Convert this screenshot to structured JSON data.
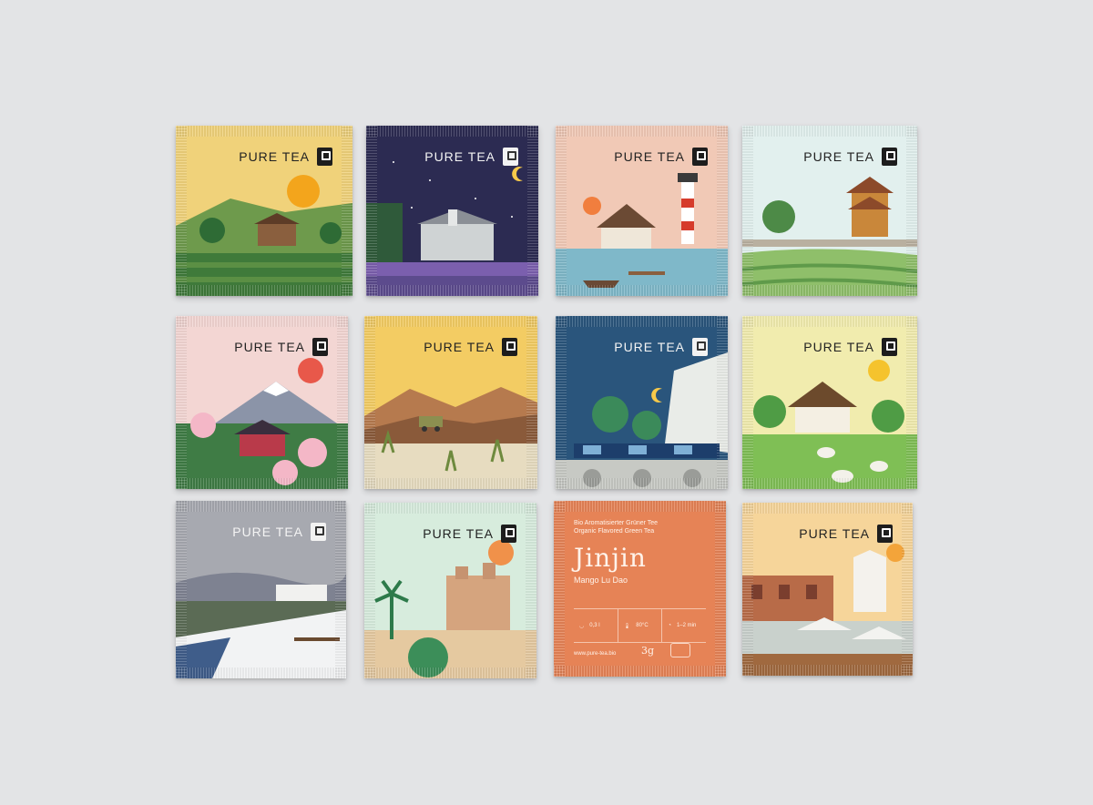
{
  "brand": "PURE TEA",
  "jinjin": {
    "subtitle_de": "Bio Aromatisierter Grüner Tee",
    "subtitle_en": "Organic Flavored Green Tea",
    "name": "Jinjin",
    "variety": "Mango Lu Dao",
    "volume": "0,3 l",
    "temperature": "80°C",
    "time": "1–2 min",
    "url": "www.pure-tea.bio",
    "weight": "3g"
  }
}
